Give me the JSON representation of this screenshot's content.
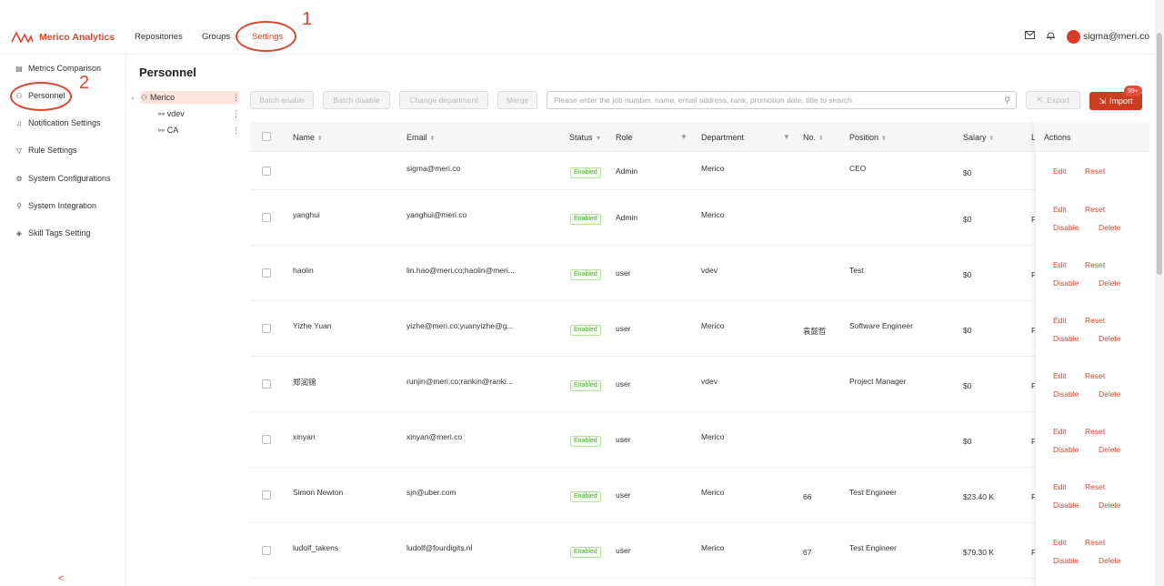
{
  "header": {
    "brand": "Merico Analytics",
    "nav": [
      "Repositories",
      "Groups",
      "Settings"
    ],
    "user": "sigma@meri.co",
    "mail_icon": "mail-icon",
    "bell_icon": "bell-icon"
  },
  "annotations": {
    "step1": "1",
    "step2": "2"
  },
  "sidebar": {
    "items": [
      {
        "label": "Metrics Comparison",
        "icon": "comparison-icon"
      },
      {
        "label": "Personnel",
        "icon": "org-icon"
      },
      {
        "label": "Notification Settings",
        "icon": "bell-icon"
      },
      {
        "label": "Rule Settings",
        "icon": "filter-icon"
      },
      {
        "label": "System Configurations",
        "icon": "gear-icon"
      },
      {
        "label": "System Integration",
        "icon": "link-icon"
      },
      {
        "label": "Skill Tags Setting",
        "icon": "tag-icon"
      }
    ],
    "collapse": "<"
  },
  "page": {
    "title": "Personnel"
  },
  "tree": {
    "root": "Merico",
    "children": [
      "vdev",
      "CA"
    ]
  },
  "toolbar": {
    "batch_enable": "Batch enable",
    "batch_disable": "Batch disable",
    "change_department": "Change department",
    "merge": "Merge",
    "search_placeholder": "Please enter the job number, name, email address, rank, promotion date, title to search",
    "export": "Export",
    "import": "Import",
    "badge": "99+"
  },
  "table": {
    "headers": {
      "name": "Name",
      "email": "Email",
      "status": "Status",
      "role": "Role",
      "department": "Department",
      "no": "No.",
      "position": "Position",
      "salary": "Salary",
      "l": "L",
      "actions": "Actions"
    },
    "rows": [
      {
        "name": "",
        "email": "sigma@meri.co",
        "status": "Enabled",
        "role": "Admin",
        "department": "Merico",
        "no": "",
        "position": "CEO",
        "salary": "$0",
        "l": "",
        "edit": "Edit",
        "reset": "Reset",
        "disable": "",
        "delete": ""
      },
      {
        "name": "yanghui",
        "email": "yanghui@meri.co",
        "status": "Enabled",
        "role": "Admin",
        "department": "Merico",
        "no": "",
        "position": "",
        "salary": "$0",
        "l": "F",
        "edit": "Edit",
        "reset": "Reset",
        "disable": "Disable",
        "delete": "Delete"
      },
      {
        "name": "haolin",
        "email": "lin.hao@meri.co;haolin@meri...",
        "status": "Enabled",
        "role": "user",
        "department": "vdev",
        "no": "",
        "position": "Test",
        "salary": "$0",
        "l": "F",
        "edit": "Edit",
        "reset": "Reset",
        "disable": "Disable",
        "delete": "Delete"
      },
      {
        "name": "Yizhe Yuan",
        "email": "yizhe@meri.co;yuanyizhe@g...",
        "status": "Enabled",
        "role": "user",
        "department": "Merico",
        "no": "袁懿哲",
        "position": "Software Engineer",
        "salary": "$0",
        "l": "F",
        "edit": "Edit",
        "reset": "Reset",
        "disable": "Disable",
        "delete": "Delete"
      },
      {
        "name": "郑润锦",
        "email": "runjin@meri.co;rankin@ranki...",
        "status": "Enabled",
        "role": "user",
        "department": "vdev",
        "no": "",
        "position": "Project Manager",
        "salary": "$0",
        "l": "F",
        "edit": "Edit",
        "reset": "Reset",
        "disable": "Disable",
        "delete": "Delete"
      },
      {
        "name": "xinyan",
        "email": "xinyan@meri.co",
        "status": "Enabled",
        "role": "user",
        "department": "Merico",
        "no": "",
        "position": "",
        "salary": "$0",
        "l": "F",
        "edit": "Edit",
        "reset": "Reset",
        "disable": "Disable",
        "delete": "Delete"
      },
      {
        "name": "Simon Newton",
        "email": "sjn@uber.com",
        "status": "Enabled",
        "role": "user",
        "department": "Merico",
        "no": "66",
        "position": "Test Engineer",
        "salary": "$23.40 K",
        "l": "F",
        "edit": "Edit",
        "reset": "Reset",
        "disable": "Disable",
        "delete": "Delete"
      },
      {
        "name": "ludolf_takens",
        "email": "ludolf@fourdigits.nl",
        "status": "Enabled",
        "role": "user",
        "department": "Merico",
        "no": "67",
        "position": "Test Engineer",
        "salary": "$79.30 K",
        "l": "F",
        "edit": "Edit",
        "reset": "Reset",
        "disable": "Disable",
        "delete": "Delete"
      }
    ]
  },
  "colors": {
    "accent": "#d9482f",
    "import_bg": "#c93d21",
    "enabled": "#52a838"
  }
}
